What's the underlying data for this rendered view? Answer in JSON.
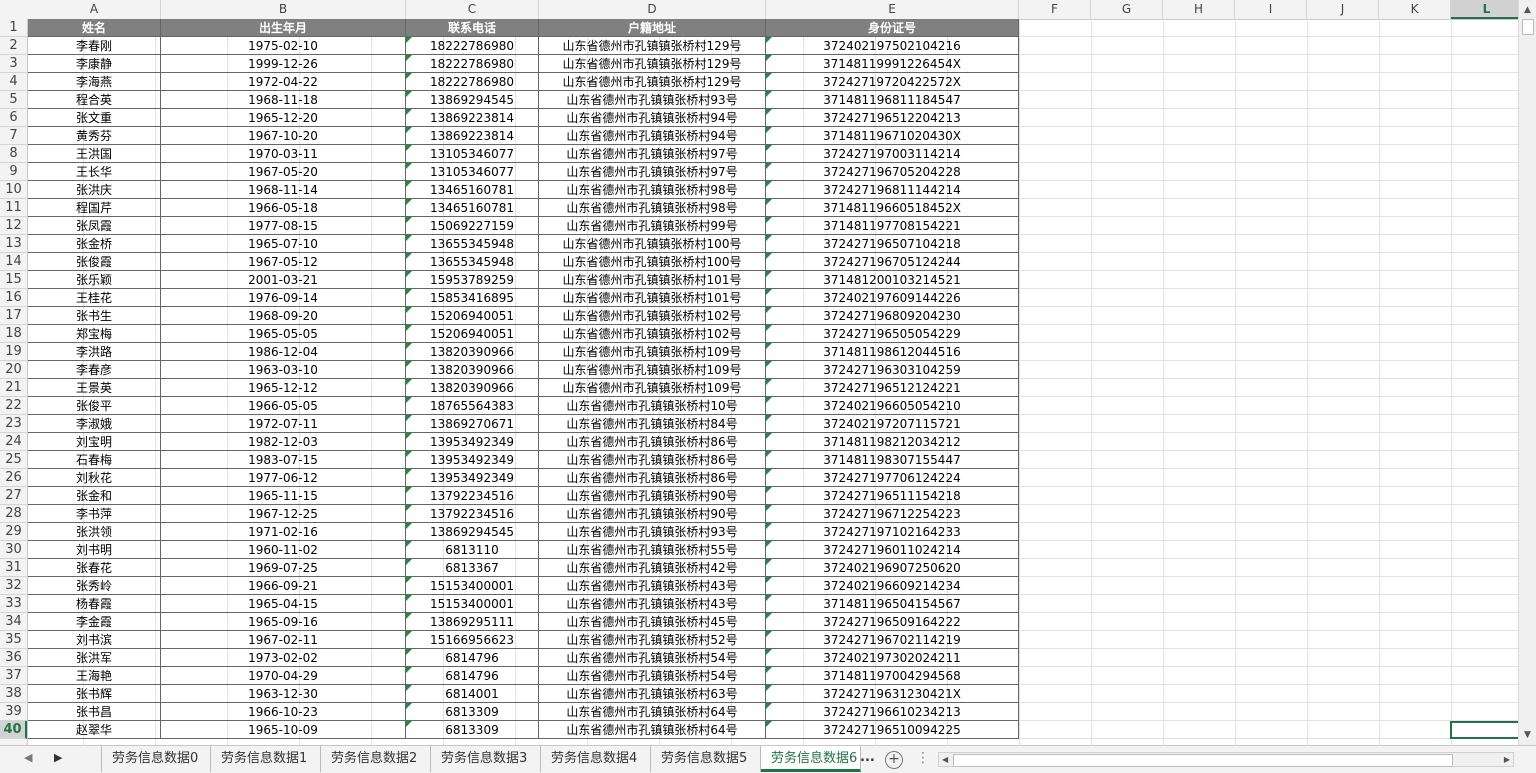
{
  "columns": [
    "A",
    "B",
    "C",
    "D",
    "E",
    "F",
    "G",
    "H",
    "I",
    "J",
    "K",
    "L"
  ],
  "selected_column": "L",
  "selected_row": "40",
  "row_numbers": [
    "1",
    "2",
    "3",
    "4",
    "5",
    "6",
    "7",
    "8",
    "9",
    "10",
    "11",
    "12",
    "13",
    "14",
    "15",
    "16",
    "17",
    "18",
    "19",
    "20",
    "21",
    "22",
    "23",
    "24",
    "25",
    "26",
    "27",
    "28",
    "29",
    "30",
    "31",
    "32",
    "33",
    "34",
    "35",
    "36",
    "37",
    "38",
    "39",
    "40"
  ],
  "headers": [
    "姓名",
    "出生年月",
    "联系电话",
    "户籍地址",
    "身份证号"
  ],
  "rows": [
    [
      "李春刚",
      "1975-02-10",
      "18222786980",
      "山东省德州市孔镇镇张桥村129号",
      "372402197502104216"
    ],
    [
      "李康静",
      "1999-12-26",
      "18222786980",
      "山东省德州市孔镇镇张桥村129号",
      "37148119991226454X"
    ],
    [
      "李海燕",
      "1972-04-22",
      "18222786980",
      "山东省德州市孔镇镇张桥村129号",
      "37242719720422572X"
    ],
    [
      "程合英",
      "1968-11-18",
      "13869294545",
      "山东省德州市孔镇镇张桥村93号",
      "371481196811184547"
    ],
    [
      "张文重",
      "1965-12-20",
      "13869223814",
      "山东省德州市孔镇镇张桥村94号",
      "372427196512204213"
    ],
    [
      "黄秀芬",
      "1967-10-20",
      "13869223814",
      "山东省德州市孔镇镇张桥村94号",
      "37148119671020430X"
    ],
    [
      "王洪国",
      "1970-03-11",
      "13105346077",
      "山东省德州市孔镇镇张桥村97号",
      "372427197003114214"
    ],
    [
      "王长华",
      "1967-05-20",
      "13105346077",
      "山东省德州市孔镇镇张桥村97号",
      "372427196705204228"
    ],
    [
      "张洪庆",
      "1968-11-14",
      "13465160781",
      "山东省德州市孔镇镇张桥村98号",
      "372427196811144214"
    ],
    [
      "程国芹",
      "1966-05-18",
      "13465160781",
      "山东省德州市孔镇镇张桥村98号",
      "37148119660518452X"
    ],
    [
      "张凤霞",
      "1977-08-15",
      "15069227159",
      "山东省德州市孔镇镇张桥村99号",
      "371481197708154221"
    ],
    [
      "张金桥",
      "1965-07-10",
      "13655345948",
      "山东省德州市孔镇镇张桥村100号",
      "372427196507104218"
    ],
    [
      "张俊霞",
      "1967-05-12",
      "13655345948",
      "山东省德州市孔镇镇张桥村100号",
      "372427196705124244"
    ],
    [
      "张乐颖",
      "2001-03-21",
      "15953789259",
      "山东省德州市孔镇镇张桥村101号",
      "371481200103214521"
    ],
    [
      "王桂花",
      "1976-09-14",
      "15853416895",
      "山东省德州市孔镇镇张桥村101号",
      "372402197609144226"
    ],
    [
      "张书生",
      "1968-09-20",
      "15206940051",
      "山东省德州市孔镇镇张桥村102号",
      "372427196809204230"
    ],
    [
      "郑宝梅",
      "1965-05-05",
      "15206940051",
      "山东省德州市孔镇镇张桥村102号",
      "372427196505054229"
    ],
    [
      "李洪路",
      "1986-12-04",
      "13820390966",
      "山东省德州市孔镇镇张桥村109号",
      "371481198612044516"
    ],
    [
      "李春彦",
      "1963-03-10",
      "13820390966",
      "山东省德州市孔镇镇张桥村109号",
      "372427196303104259"
    ],
    [
      "王景英",
      "1965-12-12",
      "13820390966",
      "山东省德州市孔镇镇张桥村109号",
      "372427196512124221"
    ],
    [
      "张俊平",
      "1966-05-05",
      "18765564383",
      "山东省德州市孔镇镇张桥村10号",
      "372402196605054210"
    ],
    [
      "李淑娥",
      "1972-07-11",
      "13869270671",
      "山东省德州市孔镇镇张桥村84号",
      "372402197207115721"
    ],
    [
      "刘宝明",
      "1982-12-03",
      "13953492349",
      "山东省德州市孔镇镇张桥村86号",
      "371481198212034212"
    ],
    [
      "石春梅",
      "1983-07-15",
      "13953492349",
      "山东省德州市孔镇镇张桥村86号",
      "371481198307155447"
    ],
    [
      "刘秋花",
      "1977-06-12",
      "13953492349",
      "山东省德州市孔镇镇张桥村86号",
      "372427197706124224"
    ],
    [
      "张金和",
      "1965-11-15",
      "13792234516",
      "山东省德州市孔镇镇张桥村90号",
      "372427196511154218"
    ],
    [
      "李书萍",
      "1967-12-25",
      "13792234516",
      "山东省德州市孔镇镇张桥村90号",
      "372427196712254223"
    ],
    [
      "张洪领",
      "1971-02-16",
      "13869294545",
      "山东省德州市孔镇镇张桥村93号",
      "372427197102164233"
    ],
    [
      "刘书明",
      "1960-11-02",
      "6813110",
      "山东省德州市孔镇镇张桥村55号",
      "372427196011024214"
    ],
    [
      "张春花",
      "1969-07-25",
      "6813367",
      "山东省德州市孔镇镇张桥村42号",
      "372402196907250620"
    ],
    [
      "张秀岭",
      "1966-09-21",
      "15153400001",
      "山东省德州市孔镇镇张桥村43号",
      "372402196609214234"
    ],
    [
      "杨春霞",
      "1965-04-15",
      "15153400001",
      "山东省德州市孔镇镇张桥村43号",
      "371481196504154567"
    ],
    [
      "李金霞",
      "1965-09-16",
      "13869295111",
      "山东省德州市孔镇镇张桥村45号",
      "372427196509164222"
    ],
    [
      "刘书滨",
      "1967-02-11",
      "15166956623",
      "山东省德州市孔镇镇张桥村52号",
      "372427196702114219"
    ],
    [
      "张洪军",
      "1973-02-02",
      "6814796",
      "山东省德州市孔镇镇张桥村54号",
      "372402197302024211"
    ],
    [
      "王海艳",
      "1970-04-29",
      "6814796",
      "山东省德州市孔镇镇张桥村54号",
      "371481197004294568"
    ],
    [
      "张书辉",
      "1963-12-30",
      "6814001",
      "山东省德州市孔镇镇张桥村63号",
      "37242719631230421X"
    ],
    [
      "张书昌",
      "1966-10-23",
      "6813309",
      "山东省德州市孔镇镇张桥村64号",
      "372427196610234213"
    ],
    [
      "赵翠华",
      "1965-10-09",
      "6813309",
      "山东省德州市孔镇镇张桥村64号",
      "372427196510094225"
    ]
  ],
  "sheet_tabs": [
    "劳务信息数据0",
    "劳务信息数据1",
    "劳务信息数据2",
    "劳务信息数据3",
    "劳务信息数据4",
    "劳务信息数据5",
    "劳务信息数据6"
  ],
  "active_tab": "劳务信息数据6",
  "more_tabs": "...",
  "add_sheet": "+",
  "colors": {
    "accent": "#217346",
    "header_fill": "#808080",
    "comment_marker": "#1e8c3a"
  }
}
